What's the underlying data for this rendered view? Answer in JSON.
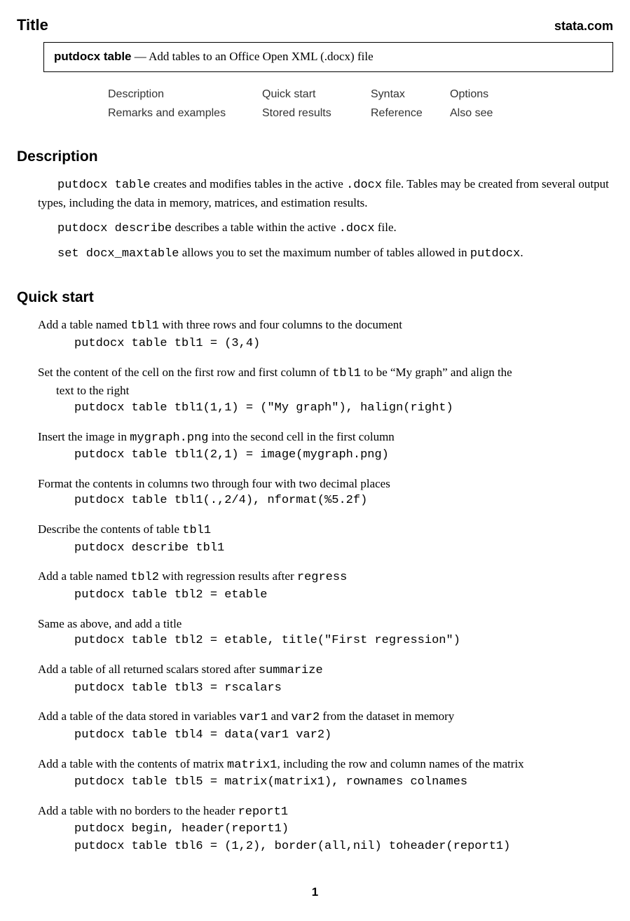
{
  "header": {
    "title_label": "Title",
    "brand": "stata.com"
  },
  "title_box": {
    "command": "putdocx table",
    "dash": " — ",
    "subtitle": "Add tables to an Office Open XML (.docx) file"
  },
  "toc": {
    "row1": [
      "Description",
      "Quick start",
      "Syntax",
      "Options"
    ],
    "row2": [
      "Remarks and examples",
      "Stored results",
      "Reference",
      "Also see"
    ]
  },
  "sections": {
    "description": {
      "heading": "Description",
      "p1a": "putdocx table",
      "p1b": " creates and modifies tables in the active ",
      "p1c": ".docx",
      "p1d": " file. Tables may be created from several output types, including the data in memory, matrices, and estimation results.",
      "p2a": "putdocx describe",
      "p2b": " describes a table within the active ",
      "p2c": ".docx",
      "p2d": " file.",
      "p3a": "set docx_maxtable",
      "p3b": " allows you to set the maximum number of tables allowed in ",
      "p3c": "putdocx",
      "p3d": "."
    },
    "quickstart": {
      "heading": "Quick start",
      "items": [
        {
          "desc_parts": [
            {
              "t": "Add a table named "
            },
            {
              "tt": "tbl1"
            },
            {
              "t": " with three rows and four columns to the document"
            }
          ],
          "code": "putdocx table tbl1 = (3,4)"
        },
        {
          "desc_parts": [
            {
              "t": "Set the content of the cell on the first row and first column of "
            },
            {
              "tt": "tbl1"
            },
            {
              "t": " to be “My graph” and align the"
            }
          ],
          "desc_cont": "text to the right",
          "code": "putdocx table tbl1(1,1) = (\"My graph\"), halign(right)"
        },
        {
          "desc_parts": [
            {
              "t": "Insert the image in "
            },
            {
              "tt": "mygraph.png"
            },
            {
              "t": " into the second cell in the first column"
            }
          ],
          "code": "putdocx table tbl1(2,1) = image(mygraph.png)"
        },
        {
          "desc_parts": [
            {
              "t": "Format the contents in columns two through four with two decimal places"
            }
          ],
          "code": "putdocx table tbl1(.,2/4), nformat(%5.2f)"
        },
        {
          "desc_parts": [
            {
              "t": "Describe the contents of table "
            },
            {
              "tt": "tbl1"
            }
          ],
          "code": "putdocx describe tbl1"
        },
        {
          "desc_parts": [
            {
              "t": "Add a table named "
            },
            {
              "tt": "tbl2"
            },
            {
              "t": " with regression results after "
            },
            {
              "tt": "regress"
            }
          ],
          "code": "putdocx table tbl2 = etable"
        },
        {
          "desc_parts": [
            {
              "t": "Same as above, and add a title"
            }
          ],
          "code": "putdocx table tbl2 = etable, title(\"First regression\")"
        },
        {
          "desc_parts": [
            {
              "t": "Add a table of all returned scalars stored after "
            },
            {
              "tt": "summarize"
            }
          ],
          "code": "putdocx table tbl3 = rscalars"
        },
        {
          "desc_parts": [
            {
              "t": "Add a table of the data stored in variables "
            },
            {
              "tt": "var1"
            },
            {
              "t": " and "
            },
            {
              "tt": "var2"
            },
            {
              "t": " from the dataset in memory"
            }
          ],
          "code": "putdocx table tbl4 = data(var1 var2)"
        },
        {
          "desc_parts": [
            {
              "t": "Add a table with the contents of matrix "
            },
            {
              "tt": "matrix1"
            },
            {
              "t": ", including the row and column names of the matrix"
            }
          ],
          "code": "putdocx table tbl5 = matrix(matrix1), rownames colnames"
        },
        {
          "desc_parts": [
            {
              "t": "Add a table with no borders to the header "
            },
            {
              "tt": "report1"
            }
          ],
          "code": "putdocx begin, header(report1)\nputdocx table tbl6 = (1,2), border(all,nil) toheader(report1)"
        }
      ]
    }
  },
  "pagenum": "1"
}
